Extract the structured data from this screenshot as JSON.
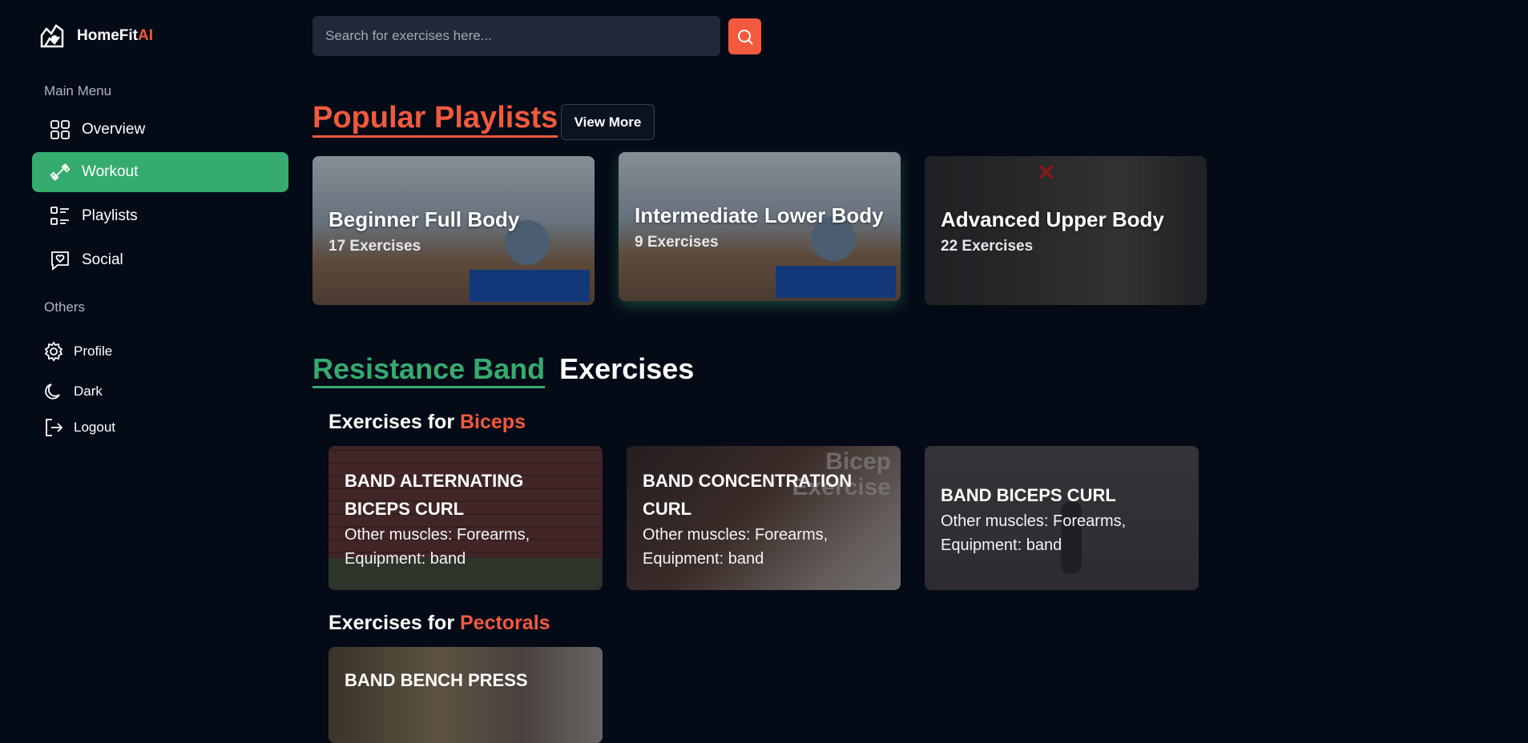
{
  "app": {
    "name_main": "HomeFit",
    "name_accent": "AI"
  },
  "sidebar": {
    "main_heading": "Main Menu",
    "items": [
      {
        "label": "Overview",
        "icon": "grid-icon",
        "active": false
      },
      {
        "label": "Workout",
        "icon": "dumbbell-icon",
        "active": true
      },
      {
        "label": "Playlists",
        "icon": "list-icon",
        "active": false
      },
      {
        "label": "Social",
        "icon": "chat-heart-icon",
        "active": false
      }
    ],
    "others_heading": "Others",
    "others": [
      {
        "label": "Profile",
        "icon": "gear-icon"
      },
      {
        "label": "Dark",
        "icon": "moon-icon"
      },
      {
        "label": "Logout",
        "icon": "logout-icon"
      }
    ]
  },
  "search": {
    "placeholder": "Search for exercises here..."
  },
  "popular": {
    "title": "Popular Playlists",
    "view_more": "View More",
    "playlists": [
      {
        "title": "Beginner Full Body",
        "count": "17 Exercises"
      },
      {
        "title": "Intermediate Lower Body",
        "count": "9 Exercises"
      },
      {
        "title": "Advanced Upper Body",
        "count": "22 Exercises"
      }
    ]
  },
  "resistance": {
    "title_accent": "Resistance Band",
    "title_rest": "Exercises",
    "groups": [
      {
        "prefix": "Exercises for",
        "muscle": "Biceps",
        "exercises": [
          {
            "name": "BAND ALTERNATING BICEPS CURL",
            "muscles": "Other muscles: Forearms,",
            "equipment": "Equipment: band"
          },
          {
            "name": "BAND CONCENTRATION CURL",
            "muscles": "Other muscles: Forearms,",
            "equipment": "Equipment: band"
          },
          {
            "name": "BAND BICEPS CURL",
            "muscles": "Other muscles: Forearms,",
            "equipment": "Equipment: band"
          }
        ]
      },
      {
        "prefix": "Exercises for",
        "muscle": "Pectorals",
        "exercises": [
          {
            "name": "BAND BENCH PRESS"
          }
        ]
      }
    ]
  },
  "colors": {
    "accent_orange": "#f15a3d",
    "accent_green": "#35ab6f",
    "background": "#050a17"
  }
}
